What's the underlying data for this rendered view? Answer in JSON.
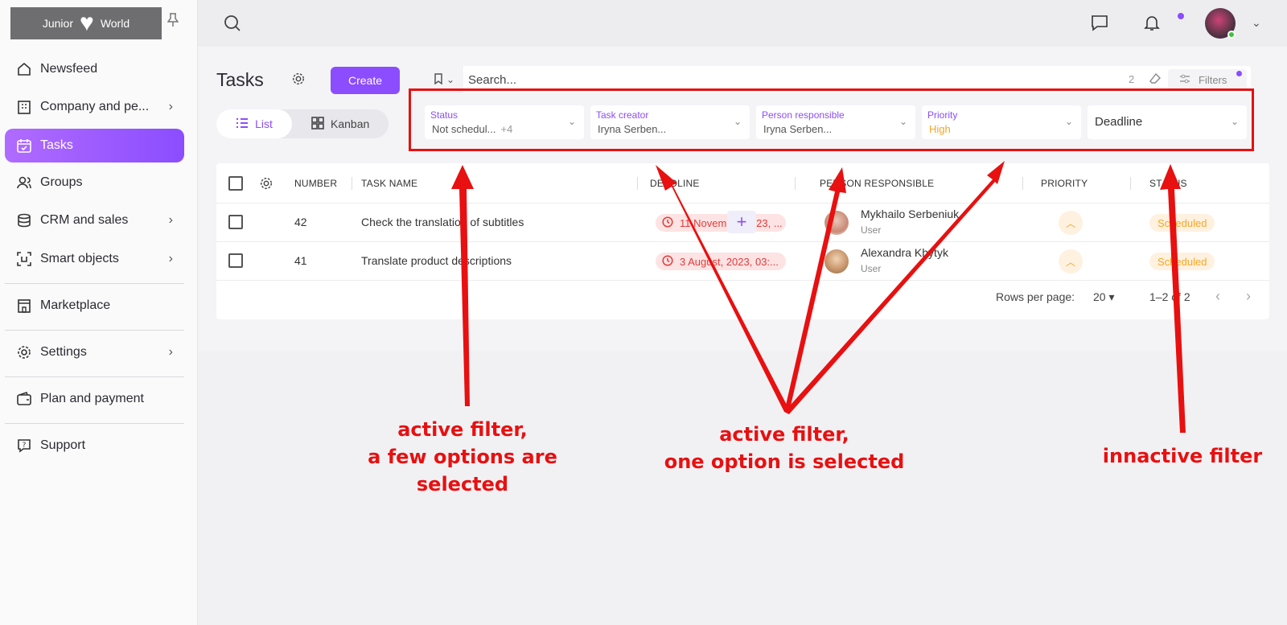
{
  "sidebar": {
    "logo_left": "Junior",
    "logo_right": "World",
    "items": [
      {
        "label": "Newsfeed"
      },
      {
        "label": "Company and pe..."
      },
      {
        "label": "Tasks"
      },
      {
        "label": "Groups"
      },
      {
        "label": "CRM and sales"
      },
      {
        "label": "Smart objects"
      },
      {
        "label": "Marketplace"
      },
      {
        "label": "Settings"
      },
      {
        "label": "Plan and payment"
      },
      {
        "label": "Support"
      }
    ]
  },
  "page": {
    "title": "Tasks",
    "create_label": "Create",
    "view_list": "List",
    "view_kanban": "Kanban"
  },
  "search": {
    "placeholder": "Search...",
    "filter_count": "2",
    "filters_label": "Filters"
  },
  "filters": [
    {
      "label": "Status",
      "value": "Not schedul...",
      "extra": "+4"
    },
    {
      "label": "Task creator",
      "value": "Iryna Serben..."
    },
    {
      "label": "Person responsible",
      "value": "Iryna Serben..."
    },
    {
      "label": "Priority",
      "value": "High"
    },
    {
      "label": "",
      "value": "Deadline"
    }
  ],
  "table": {
    "columns": [
      "NUMBER",
      "TASK NAME",
      "DEADLINE",
      "PERSON RESPONSIBLE",
      "PRIORITY",
      "STATUS"
    ],
    "rows": [
      {
        "number": "42",
        "task": "Check the translation of subtitles",
        "deadline": "11 November 2023, ...",
        "person": "Mykhailo Serbeniuk",
        "role": "User",
        "status": "Scheduled"
      },
      {
        "number": "41",
        "task": "Translate product descriptions",
        "deadline": "3 August, 2023, 03:...",
        "person": "Alexandra Khytyk",
        "role": "User",
        "status": "Scheduled"
      }
    ],
    "rows_per_page_label": "Rows per page:",
    "rows_per_page": "20",
    "range": "1–2 of 2"
  },
  "annotations": {
    "left": "active filter,\na few options are selected",
    "middle": "active filter,\none option is selected",
    "right": "innactive filter"
  },
  "colors": {
    "accent": "#8b4dff",
    "annotation": "#e81010",
    "warning": "#f5a623"
  }
}
